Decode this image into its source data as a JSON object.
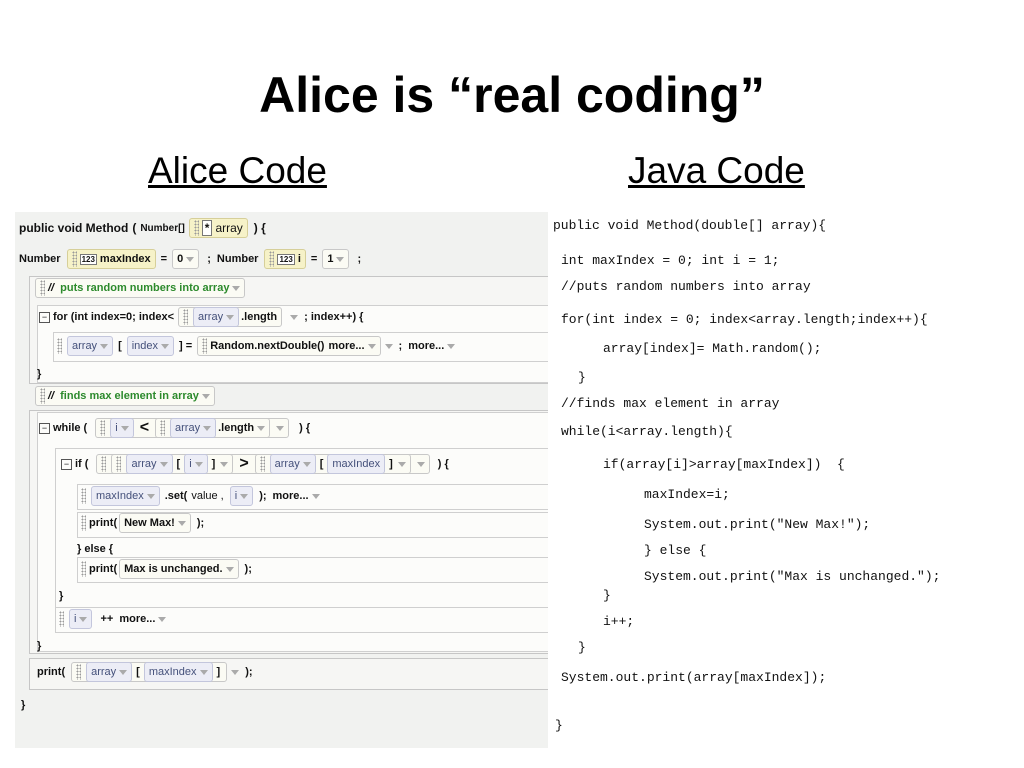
{
  "title": "Alice is “real coding”",
  "alice_heading": "Alice Code",
  "java_heading": "Java Code",
  "alice": {
    "sig": {
      "prefix": "public void Method",
      "paren_open": "(",
      "type": "Number[]",
      "star": "*",
      "param": "array",
      "paren_close": ") {"
    },
    "decl": {
      "type1": "Number",
      "icon": "123",
      "var1": "maxIndex",
      "eq1": "=",
      "val1": "0",
      "semi1": ";",
      "type2": "Number",
      "var2": "i",
      "eq2": "=",
      "val2": "1",
      "semi2": ";"
    },
    "comment1": {
      "slashes": "//",
      "text": "puts random numbers into array"
    },
    "for_head": {
      "text1": "for (int index=0; index<",
      "arr": "array",
      "len": ".length",
      "text2": "; index++) {"
    },
    "assign": {
      "arr": "array",
      "lb": "[",
      "idx": "index",
      "rb": "] =",
      "call": "Random.nextDouble()",
      "more1": "more...",
      "semi": ";",
      "more2": "more..."
    },
    "close1": "}",
    "comment2": {
      "slashes": "//",
      "text": "finds max element in array"
    },
    "while_head": {
      "kw": "while (",
      "i": "i",
      "lt": "<",
      "arr": "array",
      "len": ".length",
      "close": ") {"
    },
    "if_head": {
      "kw": "if (",
      "arr1": "array",
      "lb1": "[",
      "i": "i",
      "rb1": "]",
      "gt": ">",
      "arr2": "array",
      "lb2": "[",
      "idx": "maxIndex",
      "rb2": "]",
      "close": ") {"
    },
    "set_line": {
      "var": "maxIndex",
      "set": ".set(",
      "value": "value ,",
      "i": "i",
      "close": ");",
      "more": "more..."
    },
    "print1": {
      "fn": "print(",
      "arg": "New Max!",
      "close": ");"
    },
    "else_line": "} else {",
    "print2": {
      "fn": "print(",
      "arg": "Max is unchanged.",
      "close": ");"
    },
    "close_if": "}",
    "inc_line": {
      "i": "i",
      "op": "++",
      "more": "more..."
    },
    "close_while": "}",
    "print3": {
      "fn": "print(",
      "arr": "array",
      "lb": "[",
      "idx": "maxIndex",
      "rb": "]",
      "close": ");"
    },
    "close_method": "}"
  },
  "java_lines": [
    "public void Method(double[] array){",
    "int maxIndex = 0; int i = 1;",
    "//puts random numbers into array",
    "for(int index = 0; index<array.length;index++){",
    "array[index]= Math.random();",
    "}",
    "//finds max element in array",
    "while(i<array.length){",
    "if(array[i]>array[maxIndex])  {",
    "maxIndex=i;",
    "System.out.print(\"New Max!\");",
    "} else {",
    "System.out.print(\"Max is unchanged.\");",
    "}",
    "i++;",
    "}",
    "System.out.print(array[maxIndex]);",
    "}"
  ]
}
